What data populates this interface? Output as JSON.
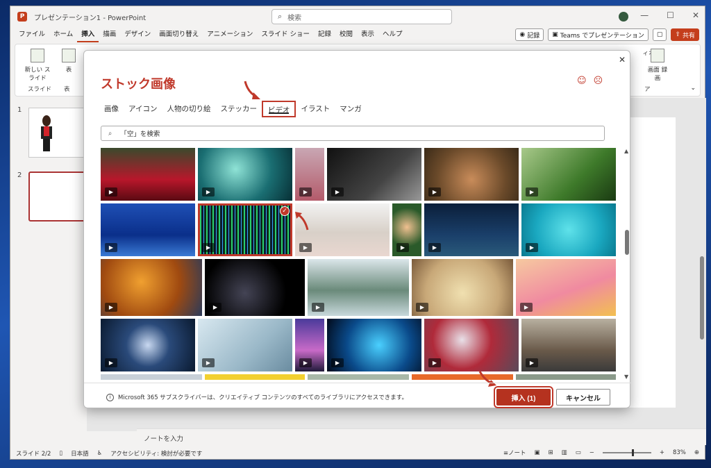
{
  "window": {
    "title": "プレゼンテーション1 - PowerPoint",
    "search_placeholder": "検索"
  },
  "menu": {
    "items": [
      "ファイル",
      "ホーム",
      "挿入",
      "描画",
      "デザイン",
      "画面切り替え",
      "アニメーション",
      "スライド ショー",
      "記録",
      "校閲",
      "表示",
      "ヘルプ"
    ],
    "active": "挿入",
    "record_label": "記録",
    "teams_label": "Teams でプレゼンテーション",
    "share_label": "共有"
  },
  "ribbon": {
    "new_slide": "新しい スライド",
    "table": "表",
    "group_slide": "スライド",
    "group_table": "表",
    "screen_record": "画面 録画",
    "video_fragment": "ィオ",
    "group_media_fragment": "ア"
  },
  "thumbnails": {
    "slide1_num": "1",
    "slide2_num": "2"
  },
  "notes_placeholder": "ノートを入力",
  "status": {
    "slide": "スライド 2/2",
    "language": "日本語",
    "accessibility": "アクセシビリティ: 検討が必要です",
    "notes_btn": "ノート",
    "zoom": "83%"
  },
  "dialog": {
    "title": "ストック画像",
    "tabs": [
      "画像",
      "アイコン",
      "人物の切り絵",
      "ステッカー",
      "ビデオ",
      "イラスト",
      "マンガ"
    ],
    "active_tab": "ビデオ",
    "search_placeholder": "「空」を検索",
    "info_text": "Microsoft 365 サブスクライバーは、クリエイティブ コンテンツのすべてのライブラリにアクセスできます。",
    "insert_label": "挿入 (1)",
    "cancel_label": "キャンセル"
  },
  "colors": {
    "accent": "#c0392b",
    "ppt_brand": "#c43e1c"
  }
}
